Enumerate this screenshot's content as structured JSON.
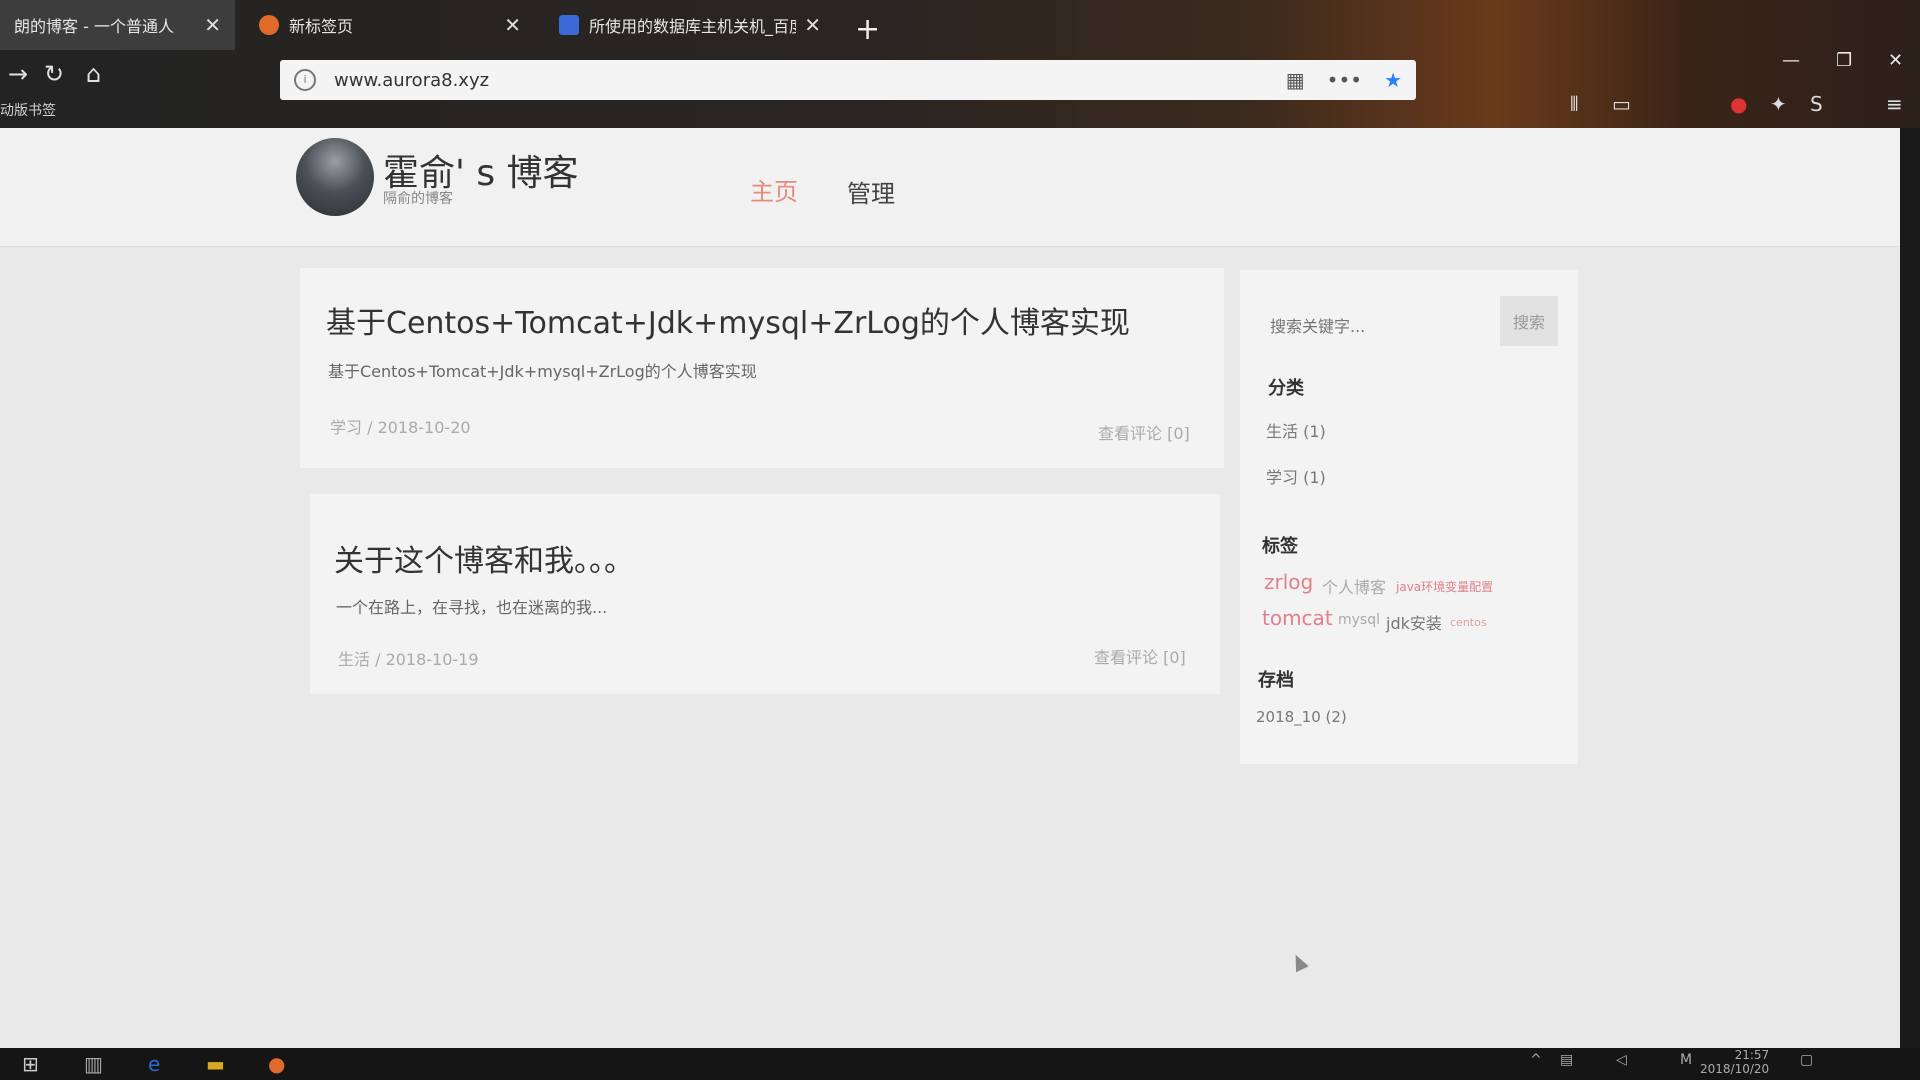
{
  "browser": {
    "tabs": [
      {
        "title": "朗的博客 - 一个普通人",
        "active": true,
        "favicon_color": "#8a8a8a"
      },
      {
        "title": "新标签页",
        "active": false,
        "favicon_color": "#e06a2a"
      },
      {
        "title": "所使用的数据库主机关机_百度",
        "active": false,
        "favicon_color": "#3a6ad8"
      }
    ],
    "new_tab": "+",
    "url": "www.aurora8.xyz",
    "bookmarks_label": "动版书签"
  },
  "header": {
    "site_title": "霍俞' s 博客",
    "site_subtitle": "隔俞的博客",
    "nav": {
      "home": "主页",
      "admin": "管理"
    }
  },
  "posts": [
    {
      "title": "基于Centos+Tomcat+Jdk+mysql+ZrLog的个人博客实现",
      "excerpt": "基于Centos+Tomcat+Jdk+mysql+ZrLog的个人博客实现",
      "meta": "学习 / 2018-10-20",
      "comments": "查看评论 [0]"
    },
    {
      "title": "关于这个博客和我。。。",
      "excerpt": "一个在路上，在寻找，也在迷离的我...",
      "meta": "生活 / 2018-10-19",
      "comments": "查看评论 [0]"
    }
  ],
  "sidebar": {
    "search_placeholder": "搜索关键字...",
    "search_button": "搜索",
    "categories_title": "分类",
    "categories": [
      "生活 (1)",
      "学习 (1)"
    ],
    "tags_title": "标签",
    "tags": [
      {
        "text": "zrlog",
        "color": "#e0808a"
      },
      {
        "text": "个人博客",
        "color": "#aaaaaa"
      },
      {
        "text": "java环境变量配置",
        "color": "#e0808a"
      },
      {
        "text": "tomcat",
        "color": "#e0808a"
      },
      {
        "text": "mysql",
        "color": "#aaaaaa"
      },
      {
        "text": "jdk安装",
        "color": "#777777"
      },
      {
        "text": "centos",
        "color": "#e0a0a0"
      }
    ],
    "archive_title": "存档",
    "archives": [
      "2018_10 (2)"
    ]
  },
  "taskbar": {
    "time": "21:57",
    "date": "2018/10/20"
  }
}
